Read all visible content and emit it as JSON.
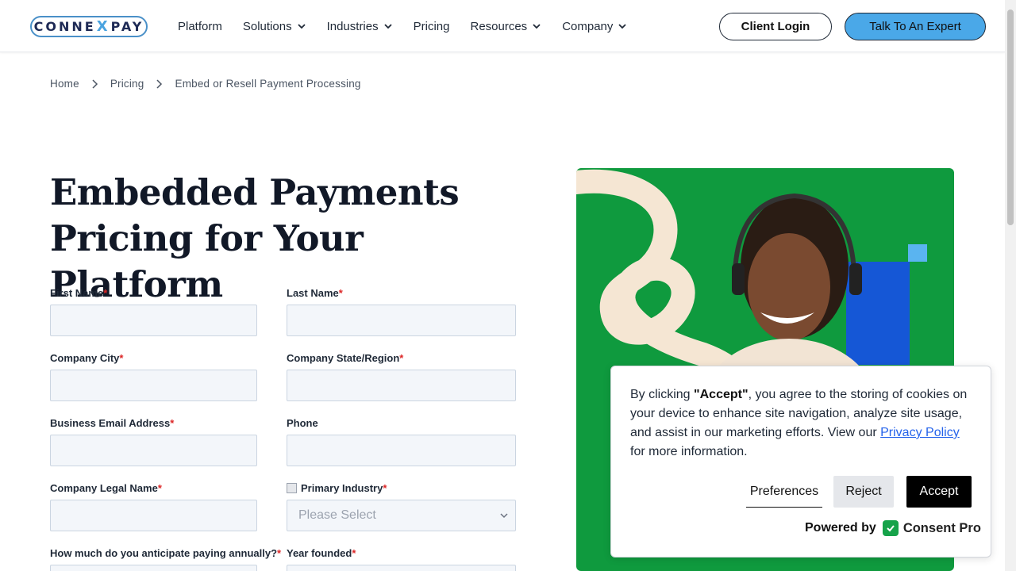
{
  "brand": {
    "logo_left": "CONNE",
    "logo_x": "X",
    "logo_right": "PAY"
  },
  "nav": {
    "items": [
      {
        "label": "Platform",
        "dropdown": false
      },
      {
        "label": "Solutions",
        "dropdown": true
      },
      {
        "label": "Industries",
        "dropdown": true
      },
      {
        "label": "Pricing",
        "dropdown": false
      },
      {
        "label": "Resources",
        "dropdown": true
      },
      {
        "label": "Company",
        "dropdown": true
      }
    ],
    "login_label": "Client Login",
    "cta_label": "Talk To An Expert"
  },
  "breadcrumb": {
    "items": [
      "Home",
      "Pricing",
      "Embed or Resell Payment Processing"
    ]
  },
  "page": {
    "title_line1": "Embedded Payments",
    "title_line2": "Pricing for Your Platform"
  },
  "form": {
    "required_mark": "*",
    "first_name_label": "First Name",
    "last_name_label": "Last Name",
    "city_label": "Company City",
    "state_label": "Company State/Region",
    "email_label": "Business Email Address",
    "phone_label": "Phone",
    "legal_name_label": "Company Legal Name",
    "industry_label": "Primary Industry",
    "industry_placeholder": "Please Select",
    "annual_label": "How much do you anticipate paying annually?",
    "founded_label": "Year founded"
  },
  "cookie": {
    "text_prefix": "By clicking ",
    "text_bold": "\"Accept\"",
    "text_main": ", you agree to the storing of cookies on your device to enhance site navigation, analyze site usage, and assist in our marketing efforts. View our ",
    "link_label": "Privacy Policy",
    "text_suffix": " for more information.",
    "preferences_label": "Preferences",
    "reject_label": "Reject",
    "accept_label": "Accept",
    "powered_label": "Powered by",
    "powered_brand": "Consent Pro"
  },
  "colors": {
    "accent": "#4aa8e8",
    "hero_green": "#0f9a3e",
    "navy": "#111827",
    "required": "#dc2626"
  }
}
